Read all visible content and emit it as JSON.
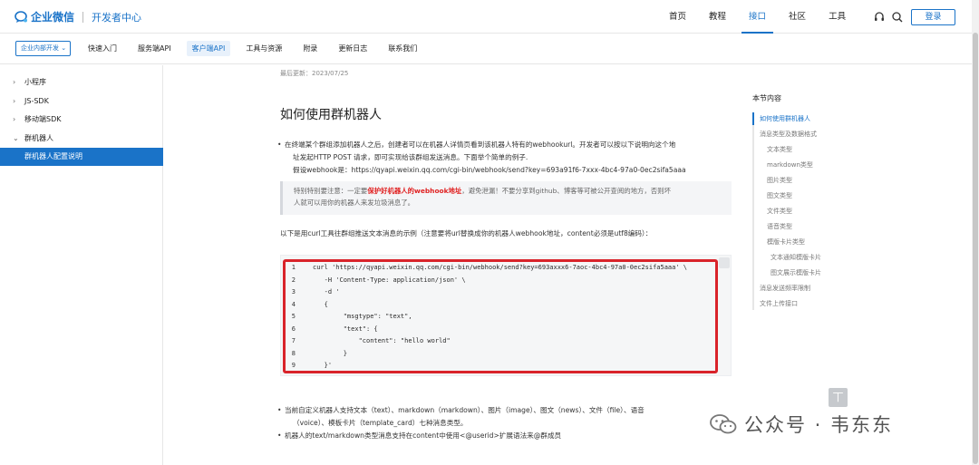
{
  "header": {
    "brand": "企业微信",
    "section": "开发者中心",
    "nav": [
      "首页",
      "教程",
      "接口",
      "社区",
      "工具"
    ],
    "active_nav": "接口",
    "login_label": "登录"
  },
  "subnav": {
    "dropdown_label": "企业内部开发 ⌄",
    "items": [
      "快速入门",
      "服务端API",
      "客户端API",
      "工具与资源",
      "附录",
      "更新日志",
      "联系我们"
    ],
    "active_item": "客户端API"
  },
  "sidebar": {
    "items": [
      {
        "label": "小程序",
        "chevron": "›"
      },
      {
        "label": "JS-SDK",
        "chevron": "›"
      },
      {
        "label": "移动端SDK",
        "chevron": "›"
      },
      {
        "label": "群机器人",
        "chevron": "⌄"
      },
      {
        "label": "群机器人配置说明",
        "chevron": ""
      }
    ]
  },
  "content": {
    "last_updated": "最后更新：2023/07/25",
    "title": "如何使用群机器人",
    "intro_line1": "在终端某个群组添加机器人之后，创建者可以在机器人详情页看到该机器人特有的webhookurl。开发者可以按以下说明向这个地",
    "intro_line2": "址发起HTTP POST 请求，即可实现给该群组发送消息。下面举个简单的例子.",
    "intro_line3": "假设webhook是：https://qyapi.weixin.qq.com/cgi-bin/webhook/send?key=693a91f6-7xxx-4bc4-97a0-0ec2sifa5aaa",
    "note_pre": "特别特别要注意：一定要",
    "note_em": "保护好机器人的webhook地址",
    "note_post": "，避免泄漏！不要分享到github、博客等可被公开查阅的地方，否则坏",
    "note_line2": "人就可以用你的机器人来发垃圾消息了。",
    "para": "以下是用curl工具往群组推送文本消息的示例（注意要将url替换成你的机器人webhook地址，content必须是utf8编码）：",
    "code": [
      {
        "n": "1",
        "t": "curl 'https://qyapi.weixin.qq.com/cgi-bin/webhook/send?key=693axxx6-7aoc-4bc4-97a0-0ec2sifa5aaa' \\"
      },
      {
        "n": "2",
        "t": "   -H 'Content-Type: application/json' \\"
      },
      {
        "n": "3",
        "t": "   -d '"
      },
      {
        "n": "4",
        "t": "   {"
      },
      {
        "n": "5",
        "t": "        \"msgtype\": \"text\","
      },
      {
        "n": "6",
        "t": "        \"text\": {"
      },
      {
        "n": "7",
        "t": "            \"content\": \"hello world\""
      },
      {
        "n": "8",
        "t": "        }"
      },
      {
        "n": "9",
        "t": "   }'"
      }
    ],
    "bullet2": "当前自定义机器人支持文本（text）、markdown（markdown）、图片（image）、图文（news）、文件（file）、语音",
    "bullet2_line2": "（voice）、模板卡片（template_card）七种消息类型。",
    "bullet3": "机器人的text/markdown类型消息支持在content中使用<@userid>扩展语法来@群成员"
  },
  "toc": {
    "title": "本节内容",
    "items": [
      {
        "label": "如何使用群机器人",
        "level": 0
      },
      {
        "label": "消息类型及数据格式",
        "level": 0
      },
      {
        "label": "文本类型",
        "level": 1
      },
      {
        "label": "markdown类型",
        "level": 1
      },
      {
        "label": "图片类型",
        "level": 1
      },
      {
        "label": "图文类型",
        "level": 1
      },
      {
        "label": "文件类型",
        "level": 1
      },
      {
        "label": "语音类型",
        "level": 1
      },
      {
        "label": "模版卡片类型",
        "level": 1
      },
      {
        "label": "文本通知模版卡片",
        "level": 2
      },
      {
        "label": "图文展示模版卡片",
        "level": 2
      },
      {
        "label": "消息发送频率限制",
        "level": 0
      },
      {
        "label": "文件上传接口",
        "level": 0
      }
    ]
  },
  "back_to_top": "丅",
  "watermark": "公众号 · 韦东东",
  "colors": {
    "brand": "#1a73c8",
    "highlight_frame": "#d9232a",
    "note_emphasis": "#e02020"
  }
}
